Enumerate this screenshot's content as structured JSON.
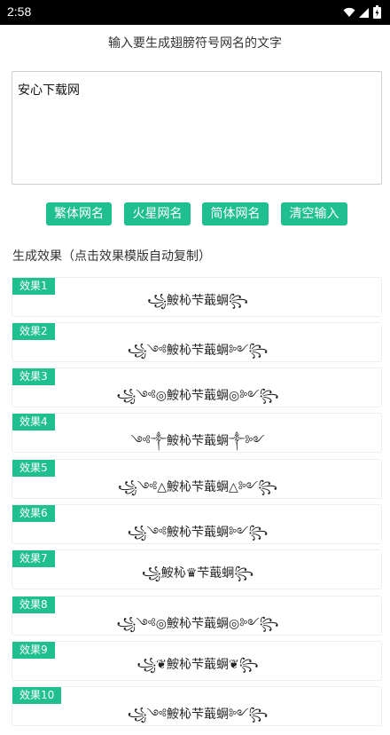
{
  "status_bar": {
    "time": "2:58"
  },
  "header": {
    "title": "输入要生成翅膀符号网名的文字"
  },
  "input": {
    "value": "安心下载网"
  },
  "buttons": {
    "traditional": "繁体网名",
    "martian": "火星网名",
    "simplified": "简体网名",
    "clear": "清空输入"
  },
  "section": {
    "label": "生成效果（点击效果模版自动复制）"
  },
  "results": [
    {
      "label": "效果1",
      "text": "꧁鮟杺芐蕺蛧꧂"
    },
    {
      "label": "效果2",
      "text": "꧁༺鮟杺芐蕺蛧༻꧂"
    },
    {
      "label": "效果3",
      "text": "꧁༺◎鮟杺芐蕺蛧◎༻꧂"
    },
    {
      "label": "效果4",
      "text": "༺༒鮟杺芐蕺蛧༒༻"
    },
    {
      "label": "效果5",
      "text": "꧁༺△鮟杺芐蕺蛧△༻꧂"
    },
    {
      "label": "效果6",
      "text": "꧁༺鮟杺芐蕺蛧༻꧂"
    },
    {
      "label": "效果7",
      "text": "꧁鮟杺♛芐蕺蛧꧂"
    },
    {
      "label": "效果8",
      "text": "꧁༺◎鮟杺芐蕺蛧◎༻꧂"
    },
    {
      "label": "效果9",
      "text": "꧁❦鮟杺芐蕺蛧❦꧂"
    },
    {
      "label": "效果10",
      "text": "꧁༺鮟杺芐蕺蛧༻꧂"
    }
  ]
}
